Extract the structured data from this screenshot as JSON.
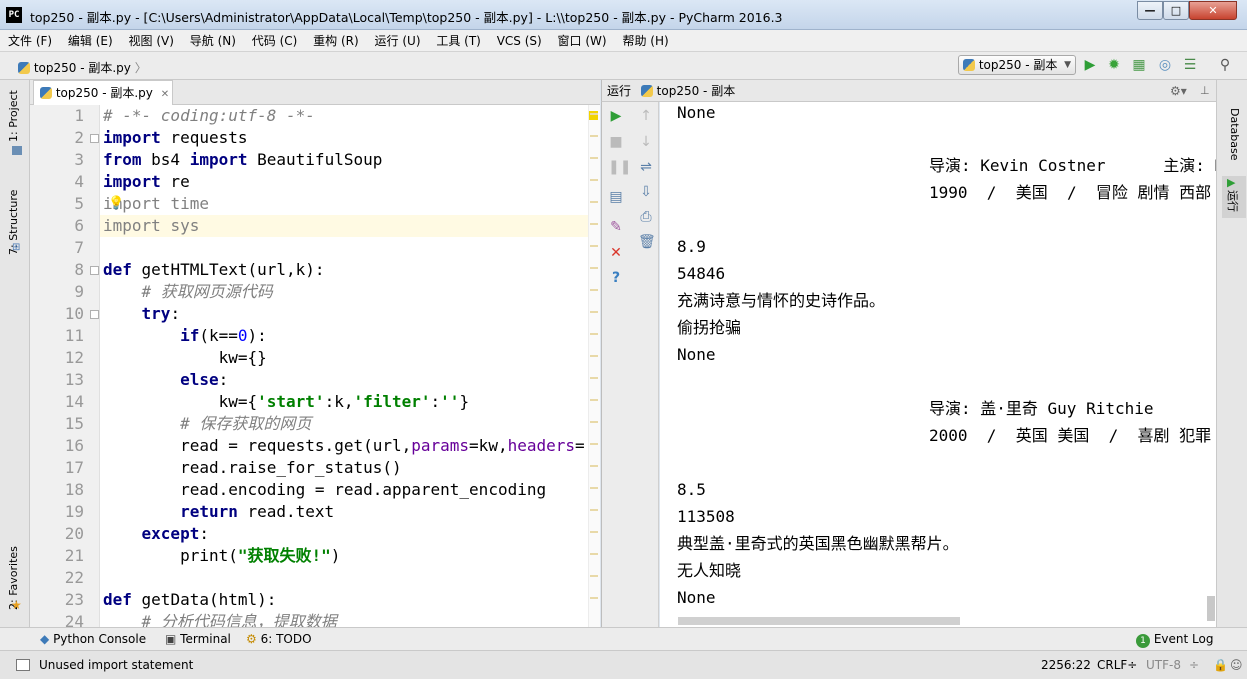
{
  "window": {
    "title": "top250 - 副本.py - [C:\\Users\\Administrator\\AppData\\Local\\Temp\\top250 - 副本.py] - L:\\\\top250 - 副本.py - PyCharm 2016.3",
    "app_icon": "PC",
    "minimize": "—",
    "maximize": "□",
    "close": "✕"
  },
  "menu": [
    {
      "label": "文件 ",
      "mnemonic": "(F)"
    },
    {
      "label": "编辑 ",
      "mnemonic": "(E)"
    },
    {
      "label": "视图 ",
      "mnemonic": "(V)"
    },
    {
      "label": "导航 ",
      "mnemonic": "(N)"
    },
    {
      "label": "代码 ",
      "mnemonic": "(C)"
    },
    {
      "label": "重构 ",
      "mnemonic": "(R)"
    },
    {
      "label": "运行 ",
      "mnemonic": "(U)"
    },
    {
      "label": "工具 ",
      "mnemonic": "(T)"
    },
    {
      "label": "VCS ",
      "mnemonic": "(S)"
    },
    {
      "label": "窗口 ",
      "mnemonic": "(W)"
    },
    {
      "label": "帮助 ",
      "mnemonic": "(H)"
    }
  ],
  "nav": {
    "breadcrumb": "top250 - 副本.py",
    "run_config": "top250 - 副本"
  },
  "left_tabs": [
    "1: Project",
    "7: Structure",
    "2: Favorites"
  ],
  "right_tabs": [
    "Database",
    "运行"
  ],
  "editor": {
    "tab_label": "top250 - 副本.py",
    "lines": [
      "1",
      "2",
      "3",
      "4",
      "5",
      "6",
      "7",
      "8",
      "9",
      "10",
      "11",
      "12",
      "13",
      "14",
      "15",
      "16",
      "17",
      "18",
      "19",
      "20",
      "21",
      "22",
      "23",
      "24"
    ],
    "code": [
      "# -*- coding:utf-8 -*-",
      "import requests",
      "from bs4 import BeautifulSoup",
      "import re",
      "import time",
      "import sys",
      "",
      "def getHTMLText(url,k):",
      "    # 获取网页源代码",
      "    try:",
      "        if(k==0):",
      "            kw={}",
      "        else:",
      "            kw={'start':k,'filter':''}",
      "        # 保存获取的网页",
      "        read = requests.get(url,params=kw,headers=",
      "        read.raise_for_status()",
      "        read.encoding = read.apparent_encoding",
      "        return read.text",
      "    except:",
      "        print(\"获取失败!\")",
      "",
      "def getData(html):",
      "    # 分析代码信息，提取数据"
    ]
  },
  "run": {
    "header_label": "运行",
    "config_name": "top250 - 副本",
    "output": [
      {
        "text": "None",
        "indent": false
      },
      {
        "text": "导演: Kevin Costner      主演: K",
        "indent": true
      },
      {
        "text": "1990  /  美国  /  冒险 剧情 西部",
        "indent": true
      },
      {
        "text": "8.9",
        "indent": false
      },
      {
        "text": "54846",
        "indent": false
      },
      {
        "text": "充满诗意与情怀的史诗作品。",
        "indent": false
      },
      {
        "text": "偷拐抢骗",
        "indent": false
      },
      {
        "text": "None",
        "indent": false
      },
      {
        "text": "导演: 盖·里奇 Guy Ritchie",
        "indent": true
      },
      {
        "text": "2000  /  英国 美国  /  喜剧 犯罪",
        "indent": true
      },
      {
        "text": "8.5",
        "indent": false
      },
      {
        "text": "113508",
        "indent": false
      },
      {
        "text": "典型盖·里奇式的英国黑色幽默黑帮片。",
        "indent": false
      },
      {
        "text": "无人知晓",
        "indent": false
      },
      {
        "text": "None",
        "indent": false
      }
    ]
  },
  "bottom_tabs": {
    "python_console": "Python Console",
    "terminal": "Terminal",
    "todo": "6: TODO",
    "event_log": "Event Log",
    "event_count": "1"
  },
  "status": {
    "message": "Unused import statement",
    "position": "2256:22",
    "line_sep": "CRLF÷",
    "encoding": "UTF-8"
  }
}
